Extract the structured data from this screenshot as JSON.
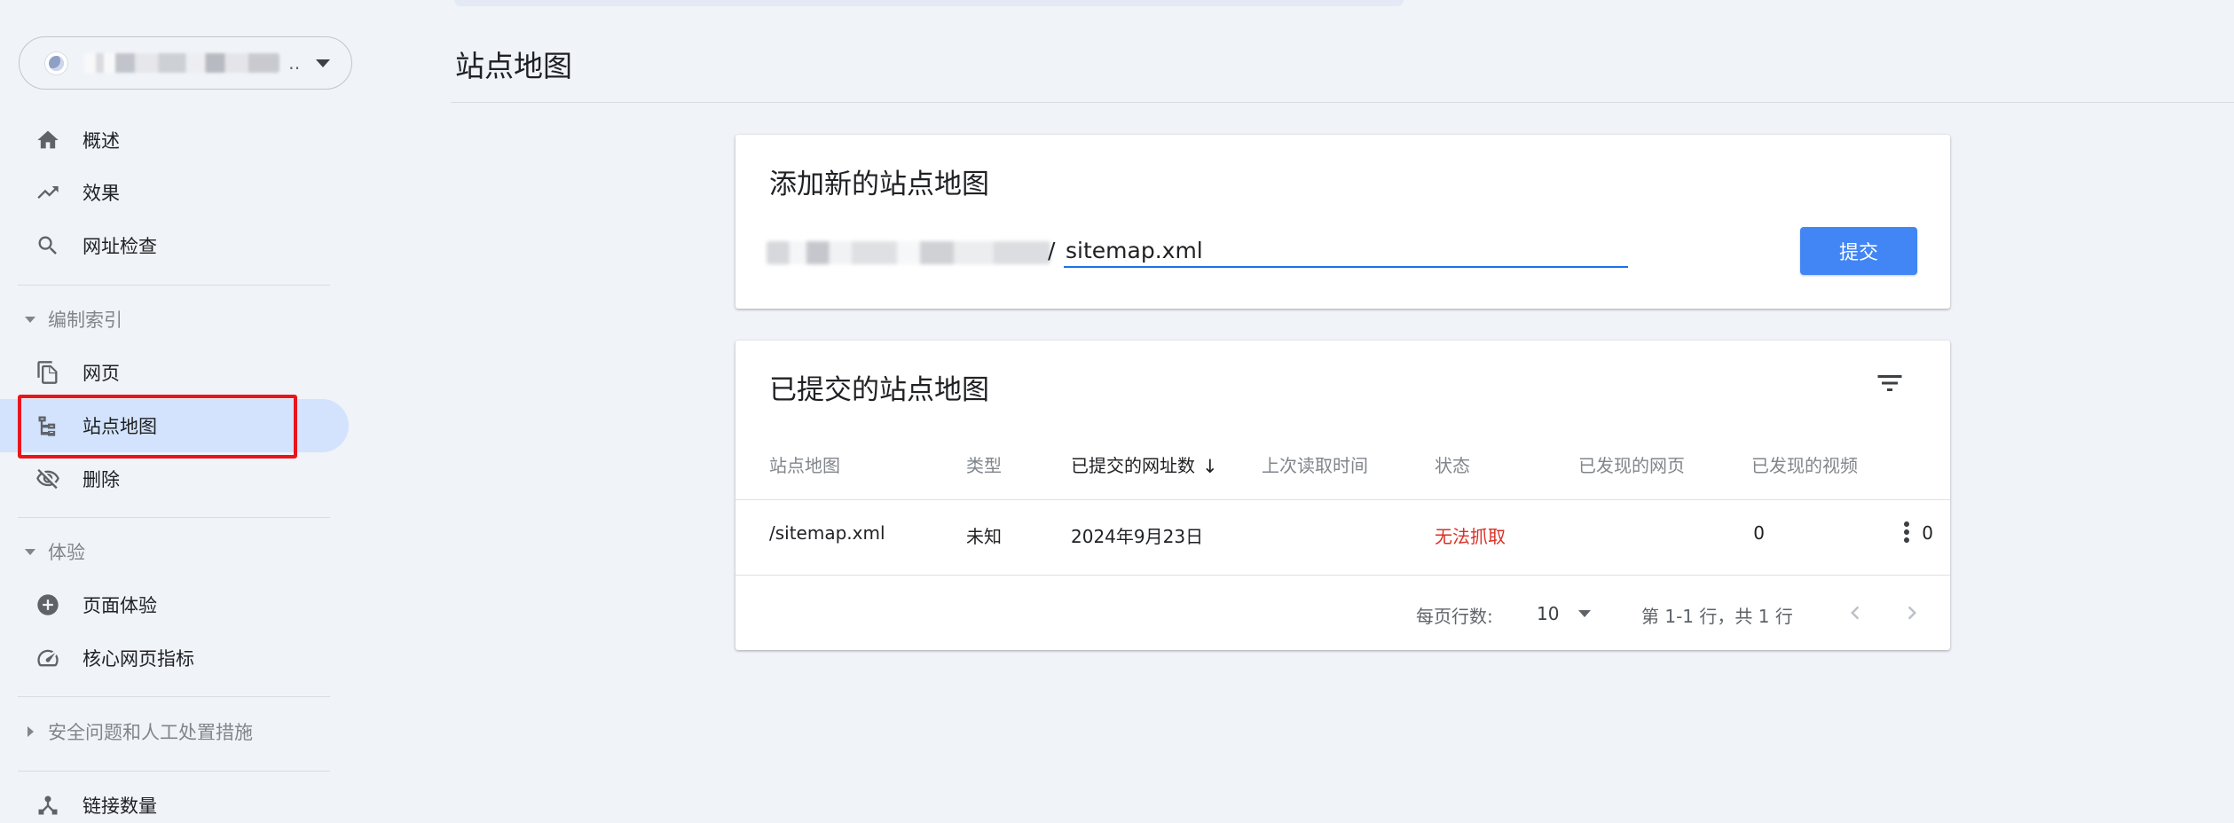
{
  "property": {
    "menu_caret": "dropdown-caret"
  },
  "sidebar": {
    "items": [
      {
        "label": "概述",
        "icon": "home-icon"
      },
      {
        "label": "效果",
        "icon": "trending-up-icon"
      },
      {
        "label": "网址检查",
        "icon": "search-icon"
      }
    ],
    "sections": [
      {
        "label": "编制索引",
        "expanded": true,
        "items": [
          {
            "label": "网页",
            "icon": "pages-icon"
          },
          {
            "label": "站点地图",
            "icon": "sitemap-icon",
            "active": true
          },
          {
            "label": "删除",
            "icon": "visibility-off-icon"
          }
        ]
      },
      {
        "label": "体验",
        "expanded": true,
        "items": [
          {
            "label": "页面体验",
            "icon": "add-circle-icon"
          },
          {
            "label": "核心网页指标",
            "icon": "speed-icon"
          }
        ]
      },
      {
        "label": "安全问题和人工处置措施",
        "expanded": false
      },
      {
        "label": "链接数量",
        "icon": "links-icon"
      }
    ]
  },
  "page": {
    "title": "站点地图"
  },
  "add_sitemap": {
    "title": "添加新的站点地图",
    "url_separator": "/",
    "input_value": "sitemap.xml",
    "submit_label": "提交"
  },
  "submitted": {
    "title": "已提交的站点地图",
    "columns": [
      "站点地图",
      "类型",
      "已提交的网址数",
      "上次读取时间",
      "状态",
      "已发现的网页",
      "已发现的视频"
    ],
    "sort_indicator": "↓",
    "rows": [
      {
        "sitemap": "/sitemap.xml",
        "type": "未知",
        "submitted": "2024年9月23日",
        "last_read": "",
        "status": "无法抓取",
        "pages": "0",
        "videos": "0"
      }
    ],
    "pager": {
      "rows_per_page_label": "每页行数:",
      "rows_per_page": "10",
      "range": "第 1-1 行，共 1 行"
    }
  },
  "colors": {
    "accent": "#4285f4",
    "active_bg": "#d3e3fd",
    "error": "#d93025",
    "highlight": "#e8151b"
  }
}
